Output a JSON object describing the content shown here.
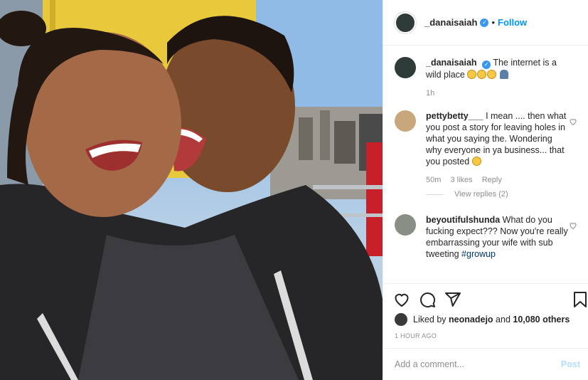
{
  "post": {
    "username": "_danaisaiah",
    "follow_label": "Follow",
    "separator": "•",
    "caption_text": "The internet is a wild place",
    "caption_time": "1h"
  },
  "comments": [
    {
      "username": "pettybetty___",
      "text": "I mean .... then what you post a story for leaving holes in what you saying the. Wondering why everyone in ya business... that you posted",
      "time": "50m",
      "likes": "3 likes",
      "reply_label": "Reply",
      "view_replies": "View replies (2)"
    },
    {
      "username": "beyoutifulshunda",
      "text": "What do you fucking expect??? Now you're really embarrassing your wife with sub tweeting",
      "hashtag": "#growup"
    }
  ],
  "likes": {
    "prefix": "Liked by",
    "user": "neonadejo",
    "and": "and",
    "count": "10,080 others"
  },
  "timestamp": "1 HOUR AGO",
  "comment_input": {
    "placeholder": "Add a comment...",
    "post_label": "Post"
  },
  "icons": {
    "like": "heart-icon",
    "comment": "comment-icon",
    "share": "share-icon",
    "save": "bookmark-icon",
    "verified": "verified-badge-icon"
  },
  "colors": {
    "accent": "#0095f6",
    "verified": "#3897f0",
    "muted": "#8e8e8e",
    "post_disabled": "#b2dffc"
  }
}
